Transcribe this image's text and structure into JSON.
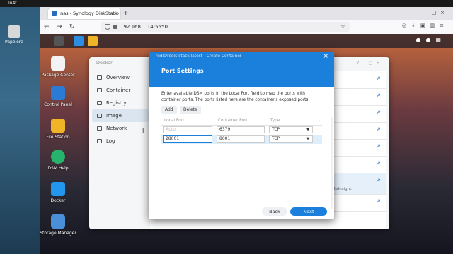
{
  "outer": {
    "title": "lu4t",
    "trash_label": "Papelera"
  },
  "browser": {
    "tab_title": "nas - Synology DiskStatio",
    "url": "192.168.1.14:5550"
  },
  "dsm": {
    "desktop_icons": [
      {
        "label": "Package Center"
      },
      {
        "label": "Control Panel"
      },
      {
        "label": "File Station"
      },
      {
        "label": "DSM Help"
      },
      {
        "label": "Docker"
      },
      {
        "label": "Storage Manager"
      }
    ]
  },
  "docker": {
    "title": "Docker",
    "nav": [
      {
        "label": "Overview"
      },
      {
        "label": "Container"
      },
      {
        "label": "Registry"
      },
      {
        "label": "Image"
      },
      {
        "label": "Network"
      },
      {
        "label": "Log"
      }
    ],
    "row_hint": "edisInsight."
  },
  "modal": {
    "subtitle": "redis/redis-stack:latest - Create Container",
    "title": "Port Settings",
    "description": "Enter available DSM ports in the Local Port field to map the ports with container ports. The ports listed here are the container's exposed ports.",
    "add_label": "Add",
    "delete_label": "Delete",
    "columns": {
      "local": "Local Port",
      "container": "Container Port",
      "type": "Type"
    },
    "rows": [
      {
        "local": "",
        "local_placeholder": "Auto",
        "container": "6379",
        "type": "TCP"
      },
      {
        "local": "28001",
        "local_placeholder": "",
        "container": "8001",
        "type": "TCP"
      }
    ],
    "back_label": "Back",
    "next_label": "Next"
  }
}
